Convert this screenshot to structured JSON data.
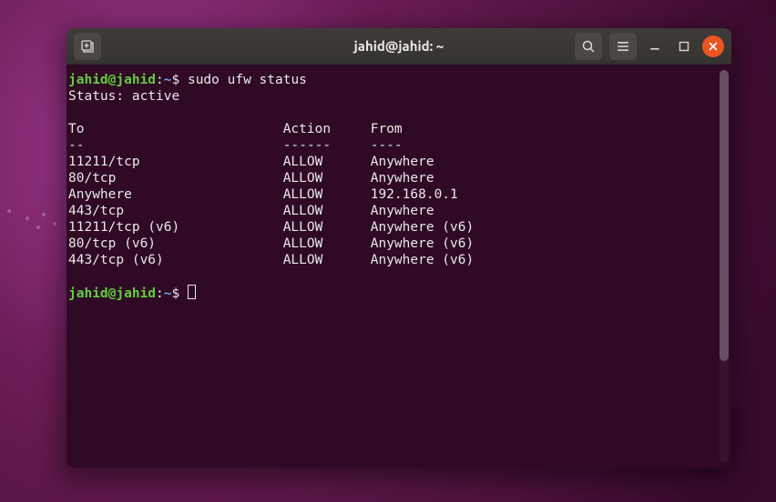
{
  "window": {
    "title": "jahid@jahid: ~"
  },
  "prompt": {
    "user": "jahid",
    "host": "jahid",
    "cwd": "~",
    "sigil": "$"
  },
  "commands": [
    {
      "cmd": "sudo ufw status"
    }
  ],
  "ufw": {
    "status_line": "Status: active",
    "headers": {
      "to": "To",
      "action": "Action",
      "from": "From"
    },
    "underlines": {
      "to": "--",
      "action": "------",
      "from": "----"
    },
    "rules": [
      {
        "to": "11211/tcp",
        "action": "ALLOW",
        "from": "Anywhere"
      },
      {
        "to": "80/tcp",
        "action": "ALLOW",
        "from": "Anywhere"
      },
      {
        "to": "Anywhere",
        "action": "ALLOW",
        "from": "192.168.0.1"
      },
      {
        "to": "443/tcp",
        "action": "ALLOW",
        "from": "Anywhere"
      },
      {
        "to": "11211/tcp (v6)",
        "action": "ALLOW",
        "from": "Anywhere (v6)"
      },
      {
        "to": "80/tcp (v6)",
        "action": "ALLOW",
        "from": "Anywhere (v6)"
      },
      {
        "to": "443/tcp (v6)",
        "action": "ALLOW",
        "from": "Anywhere (v6)"
      }
    ]
  },
  "colors": {
    "terminal_bg": "#300a24",
    "prompt_user": "#5fce3e",
    "prompt_cwd": "#6da5e8",
    "text": "#e8e8e8",
    "close_btn": "#e95420"
  }
}
